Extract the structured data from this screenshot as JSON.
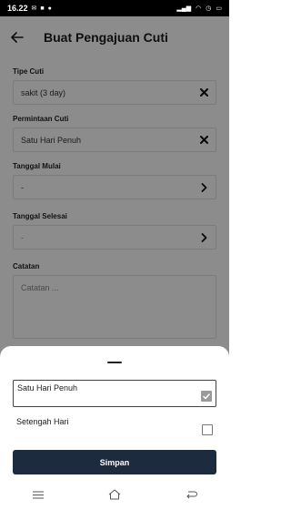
{
  "status_bar": {
    "time": "16.22"
  },
  "header": {
    "title": "Buat Pengajuan Cuti"
  },
  "form": {
    "leave_type": {
      "label": "Tipe Cuti",
      "value": "sakit (3 day)"
    },
    "leave_request": {
      "label": "Permintaan Cuti",
      "value": "Satu Hari Penuh"
    },
    "start_date": {
      "label": "Tanggal Mulai",
      "value": "-"
    },
    "end_date": {
      "label": "Tanggal Selesai",
      "value": "-"
    },
    "notes": {
      "label": "Catatan",
      "placeholder": "Catatan ..."
    }
  },
  "sheet": {
    "options": [
      {
        "label": "Satu Hari Penuh",
        "checked": true
      },
      {
        "label": "Setengah Hari",
        "checked": false
      }
    ],
    "save_label": "Simpan"
  },
  "colors": {
    "primary_button": "#1d2b3e",
    "overlay": "rgba(0,0,0,0.45)"
  },
  "icons": [
    "back-arrow-icon",
    "clear-icon",
    "chevron-right-icon",
    "checkbox-checked-icon",
    "checkbox-empty-icon",
    "menu-icon",
    "home-icon",
    "back-icon"
  ]
}
